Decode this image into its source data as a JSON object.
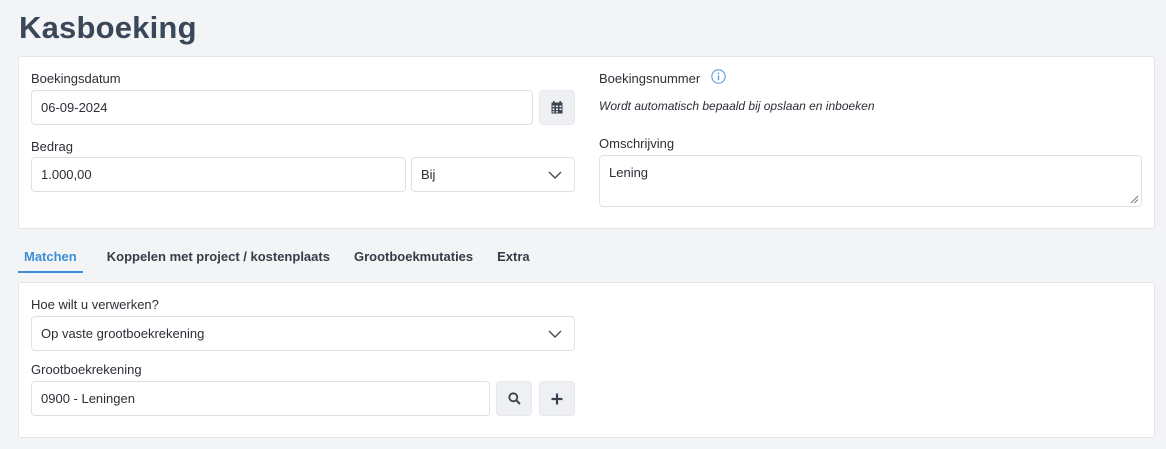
{
  "page": {
    "title": "Kasboeking"
  },
  "form": {
    "booking_date_label": "Boekingsdatum",
    "booking_date_value": "06-09-2024",
    "amount_label": "Bedrag",
    "amount_value": "1.000,00",
    "direction_value": "Bij",
    "booking_number_label": "Boekingsnummer",
    "booking_number_note": "Wordt automatisch bepaald bij opslaan en inboeken",
    "description_label": "Omschrijving",
    "description_value": "Lening"
  },
  "tabs": [
    {
      "label": "Matchen",
      "active": true
    },
    {
      "label": "Koppelen met project / kostenplaats",
      "active": false
    },
    {
      "label": "Grootboekmutaties",
      "active": false
    },
    {
      "label": "Extra",
      "active": false
    }
  ],
  "matching": {
    "process_label": "Hoe wilt u verwerken?",
    "process_value": "Op vaste grootboekrekening",
    "ledger_label": "Grootboekrekening",
    "ledger_value": "0900 - Leningen"
  },
  "icons": {
    "calendar": "calendar-icon",
    "chevron": "chevron-down-icon",
    "info": "info-icon",
    "search": "search-icon",
    "plus": "plus-icon"
  },
  "colors": {
    "accent": "#3b8fd6",
    "title": "#3a4758",
    "background": "#f3f4f6"
  }
}
